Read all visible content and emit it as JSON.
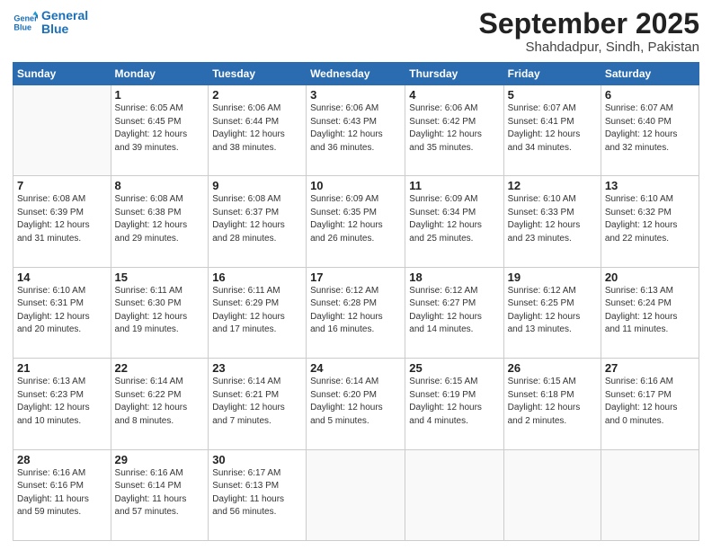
{
  "header": {
    "logo_line1": "General",
    "logo_line2": "Blue",
    "month": "September 2025",
    "location": "Shahdadpur, Sindh, Pakistan"
  },
  "weekdays": [
    "Sunday",
    "Monday",
    "Tuesday",
    "Wednesday",
    "Thursday",
    "Friday",
    "Saturday"
  ],
  "weeks": [
    [
      {
        "day": "",
        "detail": ""
      },
      {
        "day": "1",
        "detail": "Sunrise: 6:05 AM\nSunset: 6:45 PM\nDaylight: 12 hours\nand 39 minutes."
      },
      {
        "day": "2",
        "detail": "Sunrise: 6:06 AM\nSunset: 6:44 PM\nDaylight: 12 hours\nand 38 minutes."
      },
      {
        "day": "3",
        "detail": "Sunrise: 6:06 AM\nSunset: 6:43 PM\nDaylight: 12 hours\nand 36 minutes."
      },
      {
        "day": "4",
        "detail": "Sunrise: 6:06 AM\nSunset: 6:42 PM\nDaylight: 12 hours\nand 35 minutes."
      },
      {
        "day": "5",
        "detail": "Sunrise: 6:07 AM\nSunset: 6:41 PM\nDaylight: 12 hours\nand 34 minutes."
      },
      {
        "day": "6",
        "detail": "Sunrise: 6:07 AM\nSunset: 6:40 PM\nDaylight: 12 hours\nand 32 minutes."
      }
    ],
    [
      {
        "day": "7",
        "detail": "Sunrise: 6:08 AM\nSunset: 6:39 PM\nDaylight: 12 hours\nand 31 minutes."
      },
      {
        "day": "8",
        "detail": "Sunrise: 6:08 AM\nSunset: 6:38 PM\nDaylight: 12 hours\nand 29 minutes."
      },
      {
        "day": "9",
        "detail": "Sunrise: 6:08 AM\nSunset: 6:37 PM\nDaylight: 12 hours\nand 28 minutes."
      },
      {
        "day": "10",
        "detail": "Sunrise: 6:09 AM\nSunset: 6:35 PM\nDaylight: 12 hours\nand 26 minutes."
      },
      {
        "day": "11",
        "detail": "Sunrise: 6:09 AM\nSunset: 6:34 PM\nDaylight: 12 hours\nand 25 minutes."
      },
      {
        "day": "12",
        "detail": "Sunrise: 6:10 AM\nSunset: 6:33 PM\nDaylight: 12 hours\nand 23 minutes."
      },
      {
        "day": "13",
        "detail": "Sunrise: 6:10 AM\nSunset: 6:32 PM\nDaylight: 12 hours\nand 22 minutes."
      }
    ],
    [
      {
        "day": "14",
        "detail": "Sunrise: 6:10 AM\nSunset: 6:31 PM\nDaylight: 12 hours\nand 20 minutes."
      },
      {
        "day": "15",
        "detail": "Sunrise: 6:11 AM\nSunset: 6:30 PM\nDaylight: 12 hours\nand 19 minutes."
      },
      {
        "day": "16",
        "detail": "Sunrise: 6:11 AM\nSunset: 6:29 PM\nDaylight: 12 hours\nand 17 minutes."
      },
      {
        "day": "17",
        "detail": "Sunrise: 6:12 AM\nSunset: 6:28 PM\nDaylight: 12 hours\nand 16 minutes."
      },
      {
        "day": "18",
        "detail": "Sunrise: 6:12 AM\nSunset: 6:27 PM\nDaylight: 12 hours\nand 14 minutes."
      },
      {
        "day": "19",
        "detail": "Sunrise: 6:12 AM\nSunset: 6:25 PM\nDaylight: 12 hours\nand 13 minutes."
      },
      {
        "day": "20",
        "detail": "Sunrise: 6:13 AM\nSunset: 6:24 PM\nDaylight: 12 hours\nand 11 minutes."
      }
    ],
    [
      {
        "day": "21",
        "detail": "Sunrise: 6:13 AM\nSunset: 6:23 PM\nDaylight: 12 hours\nand 10 minutes."
      },
      {
        "day": "22",
        "detail": "Sunrise: 6:14 AM\nSunset: 6:22 PM\nDaylight: 12 hours\nand 8 minutes."
      },
      {
        "day": "23",
        "detail": "Sunrise: 6:14 AM\nSunset: 6:21 PM\nDaylight: 12 hours\nand 7 minutes."
      },
      {
        "day": "24",
        "detail": "Sunrise: 6:14 AM\nSunset: 6:20 PM\nDaylight: 12 hours\nand 5 minutes."
      },
      {
        "day": "25",
        "detail": "Sunrise: 6:15 AM\nSunset: 6:19 PM\nDaylight: 12 hours\nand 4 minutes."
      },
      {
        "day": "26",
        "detail": "Sunrise: 6:15 AM\nSunset: 6:18 PM\nDaylight: 12 hours\nand 2 minutes."
      },
      {
        "day": "27",
        "detail": "Sunrise: 6:16 AM\nSunset: 6:17 PM\nDaylight: 12 hours\nand 0 minutes."
      }
    ],
    [
      {
        "day": "28",
        "detail": "Sunrise: 6:16 AM\nSunset: 6:16 PM\nDaylight: 11 hours\nand 59 minutes."
      },
      {
        "day": "29",
        "detail": "Sunrise: 6:16 AM\nSunset: 6:14 PM\nDaylight: 11 hours\nand 57 minutes."
      },
      {
        "day": "30",
        "detail": "Sunrise: 6:17 AM\nSunset: 6:13 PM\nDaylight: 11 hours\nand 56 minutes."
      },
      {
        "day": "",
        "detail": ""
      },
      {
        "day": "",
        "detail": ""
      },
      {
        "day": "",
        "detail": ""
      },
      {
        "day": "",
        "detail": ""
      }
    ]
  ]
}
